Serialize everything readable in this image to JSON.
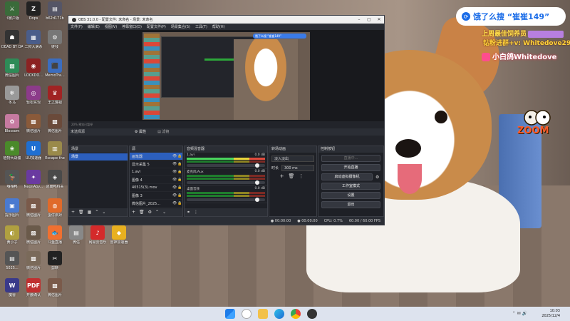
{
  "desktop": {
    "icons": [
      {
        "label": "《敏户版\n大战",
        "color": "#3a6b3a",
        "glyph": "⚔"
      },
      {
        "label": "Oops",
        "color": "#222",
        "glyph": "Z"
      },
      {
        "label": "b62d171b",
        "color": "#556",
        "glyph": "▤"
      },
      {
        "label": "DEAD BY DAYLIGHT",
        "color": "#333",
        "glyph": "☗"
      },
      {
        "label": "二狗大屠杀",
        "color": "#4a5d8a",
        "glyph": "▦"
      },
      {
        "label": "链钱",
        "color": "#777",
        "glyph": "⚙"
      },
      {
        "label": "微信图片\n2025-08...",
        "color": "#2e8b57",
        "glyph": "▩"
      },
      {
        "label": "LOCKDO...\nProtocol",
        "color": "#8b2222",
        "glyph": "◉"
      },
      {
        "label": "MemoTra...",
        "color": "#3b6dbf",
        "glyph": "⬛"
      },
      {
        "label": "冬马",
        "color": "#999",
        "glyph": "❄"
      },
      {
        "label": "轻松实现",
        "color": "#8c3b8a",
        "glyph": "◎"
      },
      {
        "label": "王之蔑视\n(The King...",
        "color": "#a02323",
        "glyph": "♛"
      },
      {
        "label": "Blossom\nVoyage",
        "color": "#c67aa0",
        "glyph": "✿"
      },
      {
        "label": "微信图片\n202507...",
        "color": "#8a5a3a",
        "glyph": "▩"
      },
      {
        "label": "微信图片\n2025...",
        "color": "#6a4a3a",
        "glyph": "▩"
      },
      {
        "label": "植物大战僵\n尸杂交版",
        "color": "#4a8a2a",
        "glyph": "❀"
      },
      {
        "label": "UU加速器",
        "color": "#1f6fd1",
        "glyph": "U"
      },
      {
        "label": "Escape the\nBackrooms",
        "color": "#9a8a4a",
        "glyph": "▥"
      },
      {
        "label": "嘎嘎鸭",
        "color": "#555",
        "glyph": "🦆"
      },
      {
        "label": "NeonAby...",
        "color": "#6a3aa0",
        "glyph": "✦"
      },
      {
        "label": "逃离鸭科夫",
        "color": "#4a4a4a",
        "glyph": "◈"
      },
      {
        "label": "提示图片",
        "color": "#4a7ad0",
        "glyph": "▣"
      },
      {
        "label": "微信图片\n2025-07...",
        "color": "#7a5a4a",
        "glyph": "▩"
      },
      {
        "label": "蛋仔派对\n大作战",
        "color": "#e06a2a",
        "glyph": "◍"
      },
      {
        "label": "黄小子",
        "color": "#b0a040",
        "glyph": "◐"
      },
      {
        "label": "微信图片\n2025...",
        "color": "#6a5a4a",
        "glyph": "▩"
      },
      {
        "label": "斗鱼直播",
        "color": "#f07030",
        "glyph": "🐟"
      },
      {
        "label": "5025...",
        "color": "#555",
        "glyph": "▤"
      },
      {
        "label": "微信图片\n202507...",
        "color": "#7a6a5a",
        "glyph": "▩"
      },
      {
        "label": "剪映",
        "color": "#222",
        "glyph": "✂"
      },
      {
        "label": "魔兽",
        "color": "#3a3a8a",
        "glyph": "W"
      },
      {
        "label": "开腰确认\n6.2.07",
        "color": "#c03030",
        "glyph": "PDF"
      },
      {
        "label": "微信图片\n2025...",
        "color": "#7a5a4a",
        "glyph": "▩"
      },
      {
        "label": "微信",
        "color": "#888",
        "glyph": "▤"
      },
      {
        "label": "网易云音乐",
        "color": "#d42a2a",
        "glyph": "♪"
      },
      {
        "label": "雷神加速器",
        "color": "#e8b020",
        "glyph": "◆"
      }
    ]
  },
  "overlay": {
    "search_text": "饿了么搜 “崔崔149”",
    "line1": "上周最佳饲养员",
    "line2": "钻粉进群+v: Whitedove299",
    "line3": "小白鸽Whitedove",
    "zoom_logo": "ZOOM"
  },
  "obs": {
    "title": "OBS 31.0.0 - 配置文件: 未命名 - 场景: 未命名",
    "menu": [
      "文件(F)",
      "编辑(E)",
      "视图(V)",
      "停靠窗口(D)",
      "配置文件(P)",
      "场景集合(S)",
      "工具(T)",
      "帮助(H)"
    ],
    "preview_banner": "饿了么搜 “崔崔149”",
    "status_strip": "20%   预览已暂停",
    "no_source_label": "未选择源",
    "tabs": [
      "⚙ 属性",
      "▤ 滤镜"
    ],
    "docks": {
      "scenes_title": "场景",
      "sources_title": "源",
      "mixer_title": "音频混音器",
      "transitions_title": "转场动画",
      "controls_title": "控制按钮"
    },
    "scenes": [
      "场景"
    ],
    "sources": [
      {
        "name": "画笔器",
        "selected": true
      },
      {
        "name": "显示采集 5",
        "selected": false
      },
      {
        "name": "1.avi",
        "selected": false
      },
      {
        "name": "图像 4",
        "selected": false
      },
      {
        "name": "40515(3).mov",
        "selected": false
      },
      {
        "name": "图像 3",
        "selected": false
      },
      {
        "name": "微信图片_2025...",
        "selected": false
      }
    ],
    "mixer": [
      {
        "name": "1.avi",
        "db": "0.0 dB"
      },
      {
        "name": "麦克风/Aux",
        "db": "0.0 dB"
      },
      {
        "name": "桌面音频",
        "db": "0.0 dB"
      }
    ],
    "transition": {
      "type": "淡入淡出",
      "duration_label": "时长",
      "duration": "300 ms"
    },
    "controls": {
      "stream": "开始直播",
      "record": "开始录制",
      "virtual_cam": "启动虚拟摄像机",
      "studio": "工作室模式",
      "settings": "设置",
      "exit": "退出",
      "disabled_top": "直播中..."
    },
    "status": {
      "live_time": "● 00:00:00",
      "rec_time": "● 00:00:00",
      "cpu": "CPU: 0.7%",
      "fps": "60.00 / 60.00 FPS"
    }
  },
  "taskbar": {
    "time": "10:03",
    "date": "2025/12/4"
  }
}
